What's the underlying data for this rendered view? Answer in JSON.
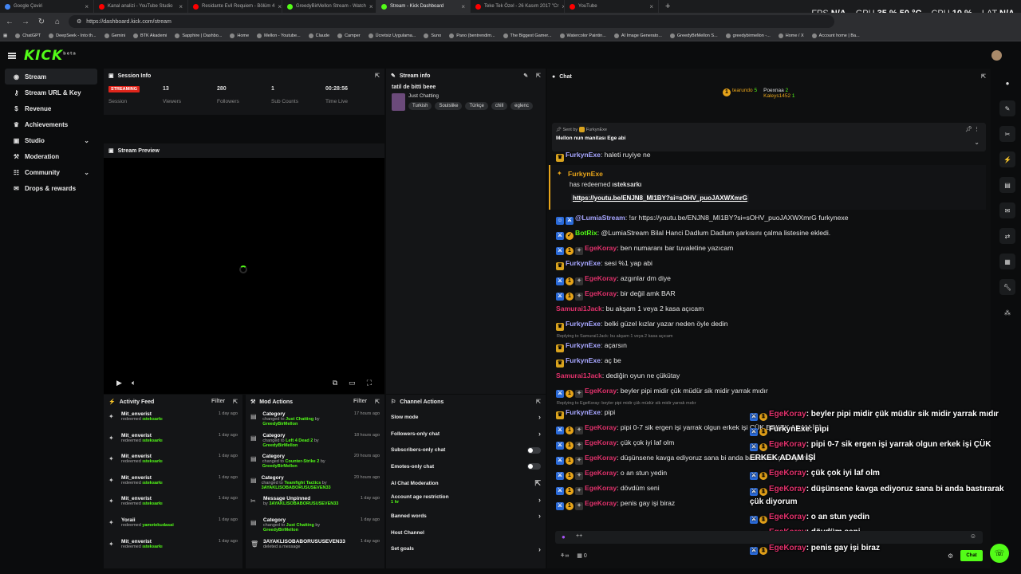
{
  "browser": {
    "tabs": [
      {
        "label": "Google Çeviri",
        "color": "#4285f4",
        "active": false
      },
      {
        "label": "Kanal analizi - YouTube Studio",
        "color": "#ff0000",
        "active": false
      },
      {
        "label": "Residante Evil Requiem - Bölüm 4",
        "color": "#ff0000",
        "active": false
      },
      {
        "label": "GreedyBirMellon Stream - Watch",
        "color": "#53fc18",
        "active": false
      },
      {
        "label": "Stream - Kick Dashboard",
        "color": "#53fc18",
        "active": true
      },
      {
        "label": "Teke Tek Özel - 26 Kasım 2017 \"Cr",
        "color": "#ff0000",
        "active": false
      },
      {
        "label": "YouTube",
        "color": "#ff0000",
        "active": false
      }
    ],
    "url": "https://dashboard.kick.com/stream",
    "bookmarks": [
      "ChatGPT",
      "DeepSeek - Into th...",
      "Gemini",
      "BTK Akademi",
      "Sapphire | Dashbo...",
      "Home",
      "Mellon - Youtube...",
      "Claude",
      "Camper",
      "Ücretsiz Uygulama...",
      "Suno",
      "Pano (bentrendim...",
      "The Biggest Gamer...",
      "Watercolor Paintin...",
      "AI Image Generato...",
      "GreedyBirMellon S...",
      "greedybirmellon -...",
      "Home / X",
      "Account home | Ba..."
    ],
    "sysmon": {
      "fps_label": "FPS",
      "fps": "N/A",
      "gpu_label": "GPU",
      "gpu": "35 %",
      "gpu_temp": "50 °C",
      "cpu_label": "CPU",
      "cpu": "10 %",
      "lat_label": "LAT",
      "lat": "N/A"
    }
  },
  "brand": {
    "logo": "KICK",
    "logo_sup": "beta",
    "accent": "#53fc18"
  },
  "sidebar": {
    "items": [
      {
        "label": "Stream",
        "icon": "broadcast-icon",
        "active": true
      },
      {
        "label": "Stream URL & Key",
        "icon": "key-icon"
      },
      {
        "label": "Revenue",
        "icon": "money-icon"
      },
      {
        "label": "Achievements",
        "icon": "trophy-icon"
      },
      {
        "label": "Studio",
        "icon": "studio-icon",
        "chevron": "⌄"
      },
      {
        "label": "Moderation",
        "icon": "hammer-icon"
      },
      {
        "label": "Community",
        "icon": "people-icon",
        "chevron": "⌄"
      },
      {
        "label": "Drops & rewards",
        "icon": "gift-icon"
      }
    ]
  },
  "session": {
    "title": "Session Info",
    "status": "STREAMING",
    "status_label": "Session",
    "stats": [
      {
        "value": "13",
        "label": "Viewers"
      },
      {
        "value": "280",
        "label": "Followers"
      },
      {
        "value": "1",
        "label": "Sub Counts"
      },
      {
        "value": "00:28:56",
        "label": "Time Live"
      }
    ]
  },
  "stream_info": {
    "title": "Stream info",
    "stream_title": "tatil de bitti beee",
    "category": "Just Chatting",
    "tags": [
      "Turkish",
      "Soulslike",
      "Türkçe",
      "chill",
      "eglenc"
    ]
  },
  "preview": {
    "title": "Stream Preview"
  },
  "activity": {
    "title": "Activity Feed",
    "filter": "Filter",
    "items": [
      {
        "name": "Mit_enverist",
        "action": "redeemed",
        "reward": "ısteksarkı",
        "time": "1 day ago"
      },
      {
        "name": "Mit_enverist",
        "action": "redeemed",
        "reward": "ısteksarkı",
        "time": "1 day ago"
      },
      {
        "name": "Mit_enverist",
        "action": "redeemed",
        "reward": "ısteksarkı",
        "time": "1 day ago"
      },
      {
        "name": "Mit_enverist",
        "action": "redeemed",
        "reward": "ısteksarkı",
        "time": "1 day ago"
      },
      {
        "name": "Mit_enverist",
        "action": "redeemed",
        "reward": "ısteksarkı",
        "time": "1 day ago"
      },
      {
        "name": "Yoraii",
        "action": "redeemed",
        "reward": "yametekudasai",
        "time": "1 day ago"
      },
      {
        "name": "Mit_enverist",
        "action": "redeemed",
        "reward": "ısteksarkı",
        "time": "1 day ago"
      }
    ]
  },
  "mod_actions": {
    "title": "Mod Actions",
    "filter": "Filter",
    "items": [
      {
        "name": "Category",
        "line1": "changed to ",
        "v1": "Just Chatting",
        "line2": " by ",
        "v2": "GreedyBirMellon",
        "time": "17 hours ago"
      },
      {
        "name": "Category",
        "line1": "changed to ",
        "v1": "Left 4 Dead 2",
        "line2": " by ",
        "v2": "GreedyBirMellon",
        "time": "18 hours ago"
      },
      {
        "name": "Category",
        "line1": "changed to ",
        "v1": "Counter-Strike 2",
        "line2": " by ",
        "v2": "GreedyBirMellon",
        "time": "20 hours ago"
      },
      {
        "name": "Category",
        "line1": "changed to ",
        "v1": "Teamfight Tactics",
        "line2": " by ",
        "v2": "3AYAKLISOBABORUSUSEVEN33",
        "time": "20 hours ago"
      },
      {
        "name": "Message Unpinned",
        "line1": "by ",
        "v1": "3AYAKLISOBABORUSUSEVEN33",
        "line2": "",
        "v2": "",
        "time": "1 day ago"
      },
      {
        "name": "Category",
        "line1": "changed to ",
        "v1": "Just Chatting",
        "line2": " by ",
        "v2": "GreedyBirMellon",
        "time": "1 day ago"
      },
      {
        "name": "3AYAKLISOBABORUSUSEVEN33",
        "line1": "deleted a message",
        "v1": "",
        "line2": "",
        "v2": "",
        "time": "1 day ago"
      }
    ]
  },
  "channel_actions": {
    "title": "Channel Actions",
    "rows": [
      {
        "label": "Slow mode",
        "kind": "chevron"
      },
      {
        "label": "Followers-only chat",
        "kind": "chevron"
      },
      {
        "label": "Subscribers-only chat",
        "kind": "toggle"
      },
      {
        "label": "Emotes-only chat",
        "kind": "toggle"
      },
      {
        "label": "AI Chat Moderation",
        "kind": "link"
      },
      {
        "label": "Account age restriction",
        "sub": "1 hr",
        "kind": "chevron"
      },
      {
        "label": "Banned words",
        "kind": "chevron"
      },
      {
        "label": "Host Channel",
        "kind": "none"
      },
      {
        "label": "Set goals",
        "kind": "chevron"
      }
    ]
  },
  "chat": {
    "title": "Chat",
    "leaderboard": [
      {
        "rank": "1",
        "name": "tearundo",
        "count": "5"
      },
      {
        "rank": "",
        "name": "Poexnaa",
        "count": "2"
      },
      {
        "rank": "",
        "name": "Kaleys1452",
        "count": "1"
      }
    ],
    "pinned_sender_label": "Sent by",
    "pinned_sender": "FurkynExe",
    "pinned_text": "Mellon nun manitası Ege abi",
    "redeem_user": "FurkynExe",
    "redeem_text": "has redeemed",
    "redeem_reward": "ısteksarkı",
    "redeem_link": "https://youtu.be/ENJN8_MI1BY?si=sOHV_puoJAXWXmrG",
    "messages": [
      {
        "user": "FurkynExe",
        "color": "#a7a6ff",
        "text": ": haleti ruyiye ne",
        "badges": [
          "crown"
        ]
      },
      {
        "user": "@LumiaStream",
        "color": "#a7a6ff",
        "text": ": !sr https://youtu.be/ENJN8_MI1BY?si=sOHV_puoJAXWXmrG furkynexe",
        "badges": [
          "bot",
          "blue"
        ]
      },
      {
        "user": "BotRix",
        "color": "#53fc18",
        "text": ": @LumiaStream Bilal Hanci Dadlum Dadlum şarkısını çalma listesine ekledi.",
        "badges": [
          "blue",
          "verified"
        ]
      },
      {
        "user": "EgeKoray",
        "color": "#e0316b",
        "text": ": ben numaranı bar tuvaletine yazıcam",
        "badges": [
          "blue",
          "gold",
          "grey"
        ]
      },
      {
        "user": "FurkynExe",
        "color": "#a7a6ff",
        "text": ": sesi %1 yap abi",
        "badges": [
          "crown"
        ]
      },
      {
        "user": "EgeKoray",
        "color": "#e0316b",
        "text": ": azgınlar dm diye",
        "badges": [
          "blue",
          "gold",
          "grey"
        ]
      },
      {
        "user": "EgeKoray",
        "color": "#e0316b",
        "text": ": bir değil amk BAR",
        "badges": [
          "blue",
          "gold",
          "grey"
        ]
      },
      {
        "user": "Samurai1Jack",
        "color": "#e0316b",
        "text": ": bu akşam 1 veya 2 kasa açıcam",
        "badges": []
      },
      {
        "user": "FurkynExe",
        "color": "#a7a6ff",
        "text": ": belki güzel kızlar yazar neden öyle dedin",
        "badges": [
          "crown"
        ]
      },
      {
        "user": "FurkynExe",
        "color": "#a7a6ff",
        "text": ": açarsın",
        "badges": [
          "crown"
        ],
        "reply": "Replying to Samurai1Jack: bu akşam 1 veya 2 kasa açıcam"
      },
      {
        "user": "FurkynExe",
        "color": "#a7a6ff",
        "text": ": aç be",
        "badges": [
          "crown"
        ]
      },
      {
        "user": "Samurai1Jack",
        "color": "#e0316b",
        "text": ": dediğin oyun ne çükütay",
        "badges": []
      },
      {
        "user": "EgeKoray",
        "color": "#e0316b",
        "text": ": beyler pipi midir çük müdür sik midir yarrak mıdır",
        "badges": [
          "blue",
          "gold",
          "grey"
        ]
      },
      {
        "user": "FurkynExe",
        "color": "#a7a6ff",
        "text": ": pipi",
        "badges": [
          "crown"
        ],
        "reply": "Replying to EgeKoray: beyler pipi midir çük müdür sik midir yarrak mıdır"
      },
      {
        "user": "EgeKoray",
        "color": "#e0316b",
        "text": ": pipi 0-7 sik ergen işi yarrak olgun erkek işi ÇÜK ERKEK ADAM İŞİ",
        "badges": [
          "blue",
          "gold",
          "grey"
        ]
      },
      {
        "user": "EgeKoray",
        "color": "#e0316b",
        "text": ": çük çok iyi laf olm",
        "badges": [
          "blue",
          "gold",
          "grey"
        ]
      },
      {
        "user": "EgeKoray",
        "color": "#e0316b",
        "text": ": düşünsene kavga ediyoruz sana bi anda bastırarak çük diyorum",
        "badges": [
          "blue",
          "gold",
          "grey"
        ]
      },
      {
        "user": "EgeKoray",
        "color": "#e0316b",
        "text": ": o an stun yedin",
        "badges": [
          "blue",
          "gold",
          "grey"
        ]
      },
      {
        "user": "EgeKoray",
        "color": "#e0316b",
        "text": ": dövdüm seni",
        "badges": [
          "blue",
          "gold",
          "grey"
        ]
      },
      {
        "user": "EgeKoray",
        "color": "#e0316b",
        "text": ": penis gay işi biraz",
        "badges": [
          "blue",
          "gold",
          "grey"
        ]
      }
    ],
    "overlay": [
      {
        "user": "EgeKoray",
        "text": ": beyler pipi midir çük müdür sik midir yarrak mıdır"
      },
      {
        "user": "FurkynExe",
        "text": ": pipi"
      },
      {
        "user": "EgeKoray",
        "text": ": pipi 0-7 sik ergen işi yarrak olgun erkek işi ÇÜK"
      },
      {
        "user": "",
        "text": "ERKEK ADAM İŞİ"
      },
      {
        "user": "EgeKoray",
        "text": ": çük çok iyi laf olm"
      },
      {
        "user": "EgeKoray",
        "text": ": düşünsene kavga ediyoruz sana bi anda bastırarak"
      },
      {
        "user": "",
        "text": "çük diyorum"
      },
      {
        "user": "EgeKoray",
        "text": ": o an stun yedin"
      },
      {
        "user": "EgeKoray",
        "text": ": dövdüm seni"
      },
      {
        "user": "EgeKoray",
        "text": ": penis gay işi biraz"
      }
    ],
    "input_placeholder": "",
    "points": "0",
    "send_label": "Chat"
  }
}
